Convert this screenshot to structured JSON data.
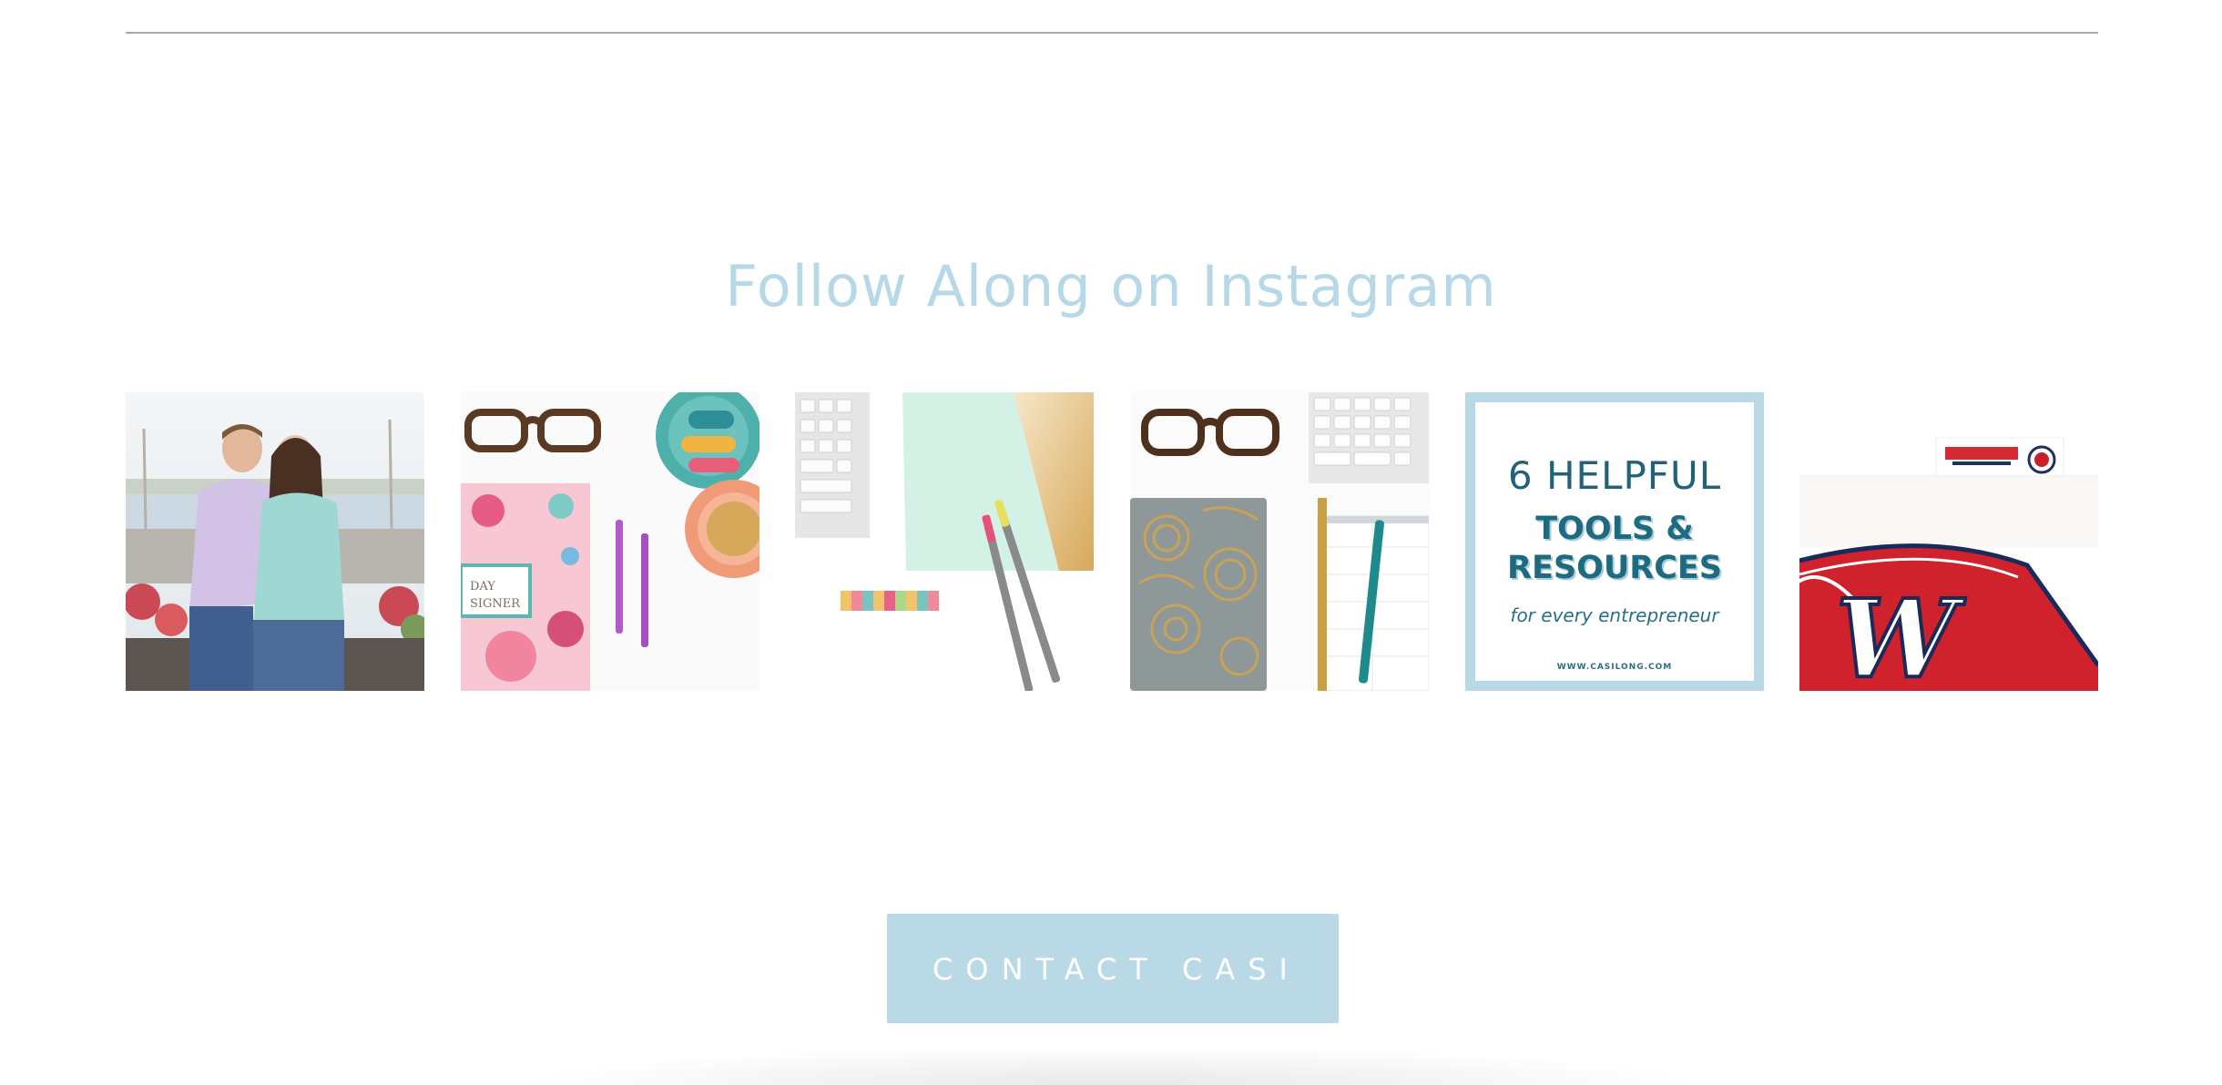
{
  "section": {
    "title": "Follow Along on Instagram"
  },
  "instagram": {
    "posts": [
      {
        "icon": "couple-photo"
      },
      {
        "icon": "planner-flatlay-photo"
      },
      {
        "icon": "desk-flatlay-photo"
      },
      {
        "icon": "notebook-flatlay-photo"
      },
      {
        "icon": "promo-graphic",
        "line1": "6 HELPFUL",
        "line2": "TOOLS &",
        "line3": "RESOURCES",
        "tagline": "for every entrepreneur",
        "url": "WWW.CASILONG.COM"
      },
      {
        "icon": "nationals-jersey-photo"
      }
    ]
  },
  "contact": {
    "button_label": "CONTACT CASI"
  },
  "colors": {
    "accent": "#b9d9e6",
    "title": "#b7d8e6",
    "promo_text": "#1f5e74",
    "divider": "#a9a9a9"
  }
}
